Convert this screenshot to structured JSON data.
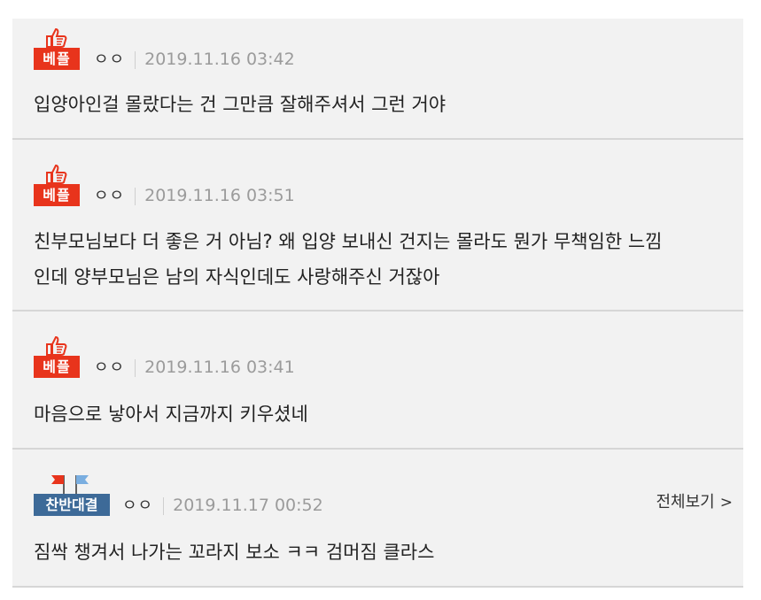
{
  "comments": [
    {
      "badge": "베플",
      "badge_type": "best",
      "badge_icon": "thumbs-up-icon",
      "user": "ㅇㅇ",
      "timestamp": "2019.11.16 03:42",
      "lines": [
        "입양아인걸 몰랐다는 건 그만큼 잘해주셔서 그런 거야"
      ]
    },
    {
      "badge": "베플",
      "badge_type": "best",
      "badge_icon": "thumbs-up-icon",
      "user": "ㅇㅇ",
      "timestamp": "2019.11.16 03:51",
      "lines": [
        "친부모님보다 더 좋은 거 아님? 왜 입양 보내신 건지는 몰라도 뭔가 무책임한 느낌",
        "인데 양부모님은 남의 자식인데도 사랑해주신 거잖아"
      ]
    },
    {
      "badge": "베플",
      "badge_type": "best",
      "badge_icon": "thumbs-up-icon",
      "user": "ㅇㅇ",
      "timestamp": "2019.11.16 03:41",
      "lines": [
        "마음으로 낳아서 지금까지 키우셨네"
      ]
    },
    {
      "badge": "찬반대결",
      "badge_type": "debate",
      "badge_icon": "flags-icon",
      "user": "ㅇㅇ",
      "timestamp": "2019.11.17 00:52",
      "view_all": "전체보기",
      "lines": [
        "짐싹 챙겨서 나가는 꼬라지 보소 ㅋㅋ 검머짐 클라스"
      ]
    }
  ],
  "colors": {
    "best_badge": "#e8341c",
    "debate_badge": "#3d6a98",
    "background": "#f2f2f2",
    "divider": "#d6d6d6"
  }
}
